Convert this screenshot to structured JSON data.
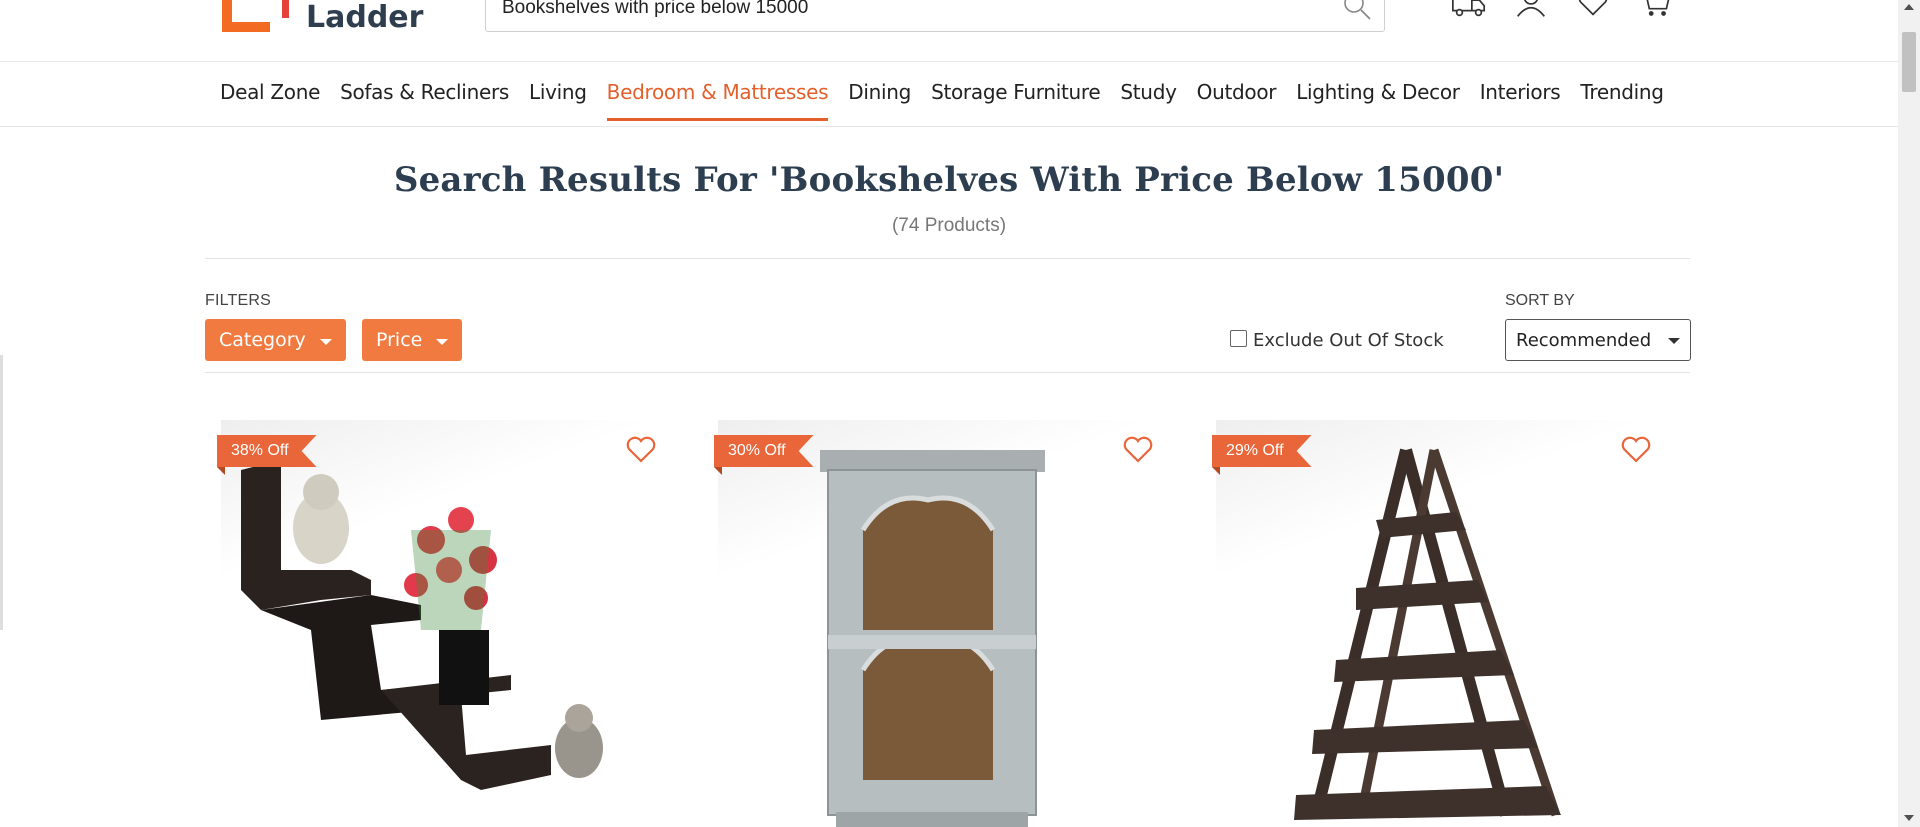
{
  "header": {
    "logo_text": "Ladder",
    "search_value": "Bookshelves with price below 15000",
    "icons": [
      "delivery-truck-icon",
      "user-icon",
      "heart-icon",
      "cart-icon"
    ]
  },
  "nav": {
    "items": [
      {
        "label": "Deal Zone",
        "active": false
      },
      {
        "label": "Sofas & Recliners",
        "active": false
      },
      {
        "label": "Living",
        "active": false
      },
      {
        "label": "Bedroom & Mattresses",
        "active": true
      },
      {
        "label": "Dining",
        "active": false
      },
      {
        "label": "Storage Furniture",
        "active": false
      },
      {
        "label": "Study",
        "active": false
      },
      {
        "label": "Outdoor",
        "active": false
      },
      {
        "label": "Lighting & Decor",
        "active": false
      },
      {
        "label": "Interiors",
        "active": false
      },
      {
        "label": "Trending",
        "active": false
      }
    ]
  },
  "results": {
    "title": "Search Results For 'Bookshelves With Price Below 15000'",
    "count": "(74 Products)"
  },
  "filters": {
    "label": "FILTERS",
    "buttons": [
      {
        "label": "Category"
      },
      {
        "label": "Price"
      }
    ],
    "exclude_out_of_stock": "Exclude Out Of Stock"
  },
  "sort": {
    "label": "SORT BY",
    "selected": "Recommended"
  },
  "products": [
    {
      "discount": "38% Off"
    },
    {
      "discount": "30% Off"
    },
    {
      "discount": "29% Off"
    }
  ],
  "colors": {
    "accent": "#e35f2c",
    "filter_button": "#f07a3f",
    "badge": "#e8663a",
    "title": "#2d3e50"
  }
}
